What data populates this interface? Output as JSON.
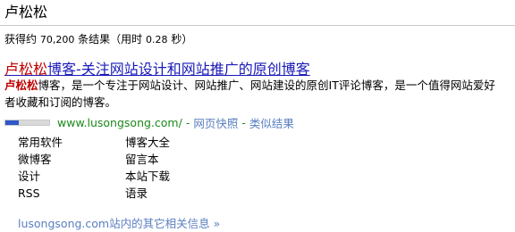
{
  "search": {
    "query": "卢松松"
  },
  "stats": {
    "prefix": "获得约",
    "count": "70,200",
    "middle": "条结果（用时",
    "time": "0.28",
    "suffix": "秒）"
  },
  "result": {
    "title_highlight": "卢松松",
    "title_rest": "博客-关注网站设计和网站推广的原创博客",
    "snippet_highlight": "卢松松",
    "snippet_rest": "博客，是一个专注于网站设计、网站推广、网站建设的原创IT评论博客，是一个值得网站爱好者收藏和订阅的博客。",
    "pagerank_fraction": 0.3,
    "url": "www.lusongsong.com/",
    "separator": "-",
    "cache_label": "网页快照",
    "similar_label": "类似结果",
    "sitelinks": [
      "常用软件",
      "博客大全",
      "微博客",
      "留言本",
      "设计",
      "本站下载",
      "RSS",
      "语录"
    ],
    "more_label": "lusongsong.com站内的其它相关信息 »"
  },
  "colors": {
    "link": "#1a1ab8",
    "highlight": "#c00000",
    "url": "#1a8a1a",
    "secondary_link": "#5a7fc0"
  }
}
